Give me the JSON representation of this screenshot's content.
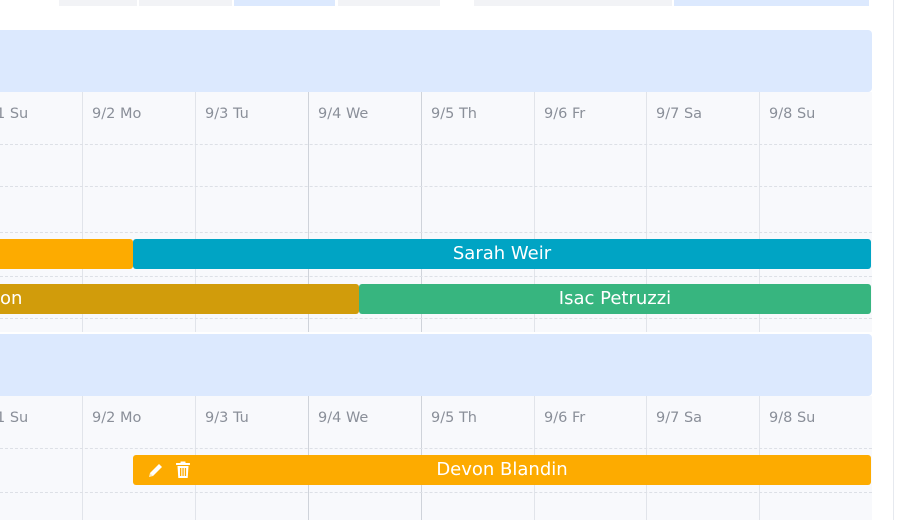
{
  "colors": {
    "header_bg": "#dce9fe",
    "grid_bg": "#f8f9fc",
    "orange": "#fdab00",
    "teal": "#00a4c4",
    "mustard": "#d19c0b",
    "green": "#37b57f"
  },
  "top_strip": [
    "#f2f3f6",
    "#dce9fe"
  ],
  "sections": [
    {
      "days": [
        "1 Su",
        "9/2 Mo",
        "9/3 Tu",
        "9/4 We",
        "9/5 Th",
        "9/6 Fr",
        "9/7 Sa",
        "9/8 Su"
      ],
      "bars": [
        {
          "label": "",
          "color": "orange",
          "row": 2
        },
        {
          "label": "Sarah Weir",
          "color": "teal",
          "row": 2
        },
        {
          "label": "on",
          "color": "mustard",
          "row": 3
        },
        {
          "label": "Isac Petruzzi",
          "color": "green",
          "row": 3
        }
      ]
    },
    {
      "days": [
        "1 Su",
        "9/2 Mo",
        "9/3 Tu",
        "9/4 We",
        "9/5 Th",
        "9/6 Fr",
        "9/7 Sa",
        "9/8 Su"
      ],
      "bars": [
        {
          "label": "Devon Blandin",
          "color": "orange",
          "row": 1,
          "icons": [
            "pencil-icon",
            "trash-icon"
          ]
        }
      ]
    }
  ]
}
